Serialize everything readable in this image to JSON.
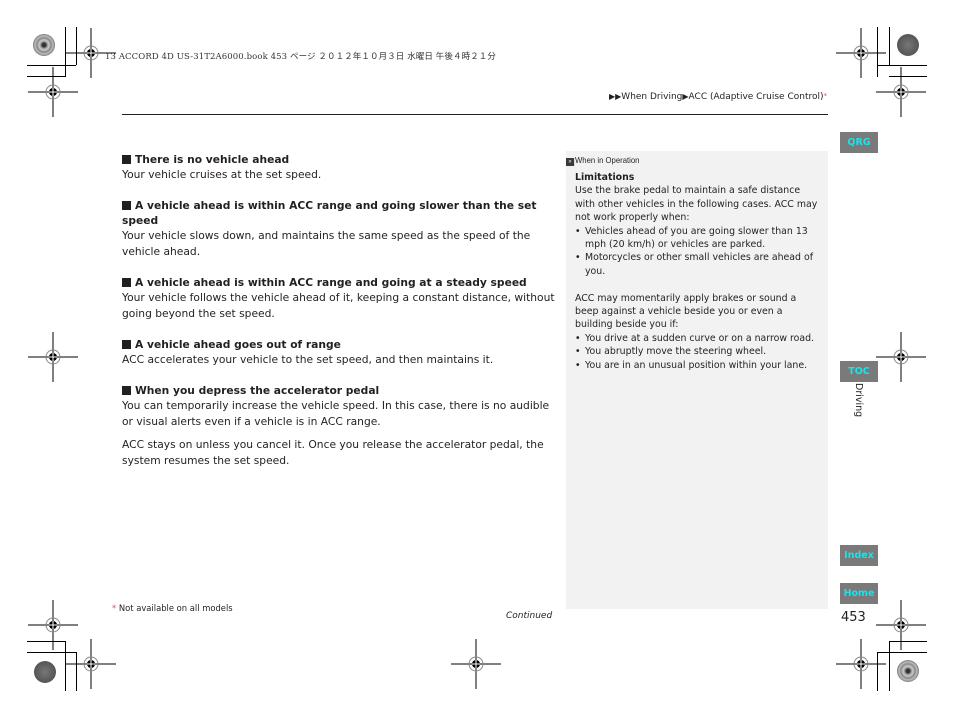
{
  "printer_header": "13 ACCORD 4D US-31T2A6000.book  453 ページ  ２０１２年１０月３日  水曜日  午後４時２１分",
  "breadcrumb": {
    "items": [
      "When Driving",
      "ACC (Adaptive Cruise Control)"
    ],
    "marker": "*"
  },
  "main": {
    "sections": [
      {
        "heading": "There is no vehicle ahead",
        "text": "Your vehicle cruises at the set speed."
      },
      {
        "heading": "A vehicle ahead is within ACC range and going slower than the set speed",
        "text": "Your vehicle slows down, and maintains the same speed as the speed of the vehicle ahead."
      },
      {
        "heading": "A vehicle ahead is within ACC range and going at a steady speed",
        "text": "Your vehicle follows the vehicle ahead of it, keeping a constant distance, without going beyond the set speed."
      },
      {
        "heading": "A vehicle ahead goes out of range",
        "text": "ACC accelerates your vehicle to the set speed, and then maintains it."
      },
      {
        "heading": "When you depress the accelerator pedal",
        "text": "You can temporarily increase the vehicle speed. In this case, there is no audible or visual alerts even if a vehicle is in ACC range.",
        "text2": "ACC stays on unless you cancel it. Once you release the accelerator pedal, the system resumes the set speed."
      }
    ]
  },
  "sidebar": {
    "header": "When in Operation",
    "title": "Limitations",
    "intro": "Use the brake pedal to maintain a safe distance with other vehicles in the following cases. ACC may not work properly when:",
    "bullets1": [
      "Vehicles ahead of you are going slower than 13 mph (20 km/h) or vehicles are parked.",
      "Motorcycles or other small vehicles are ahead of you."
    ],
    "para2": "ACC may momentarily apply brakes or sound a beep against a vehicle beside you or even a building beside you if:",
    "bullets2": [
      "You drive at a sudden curve or on a narrow road.",
      "You abruptly move the steering wheel.",
      "You are in an unusual position within your lane."
    ]
  },
  "nav_tabs": {
    "qrg": "QRG",
    "toc": "TOC",
    "index": "Index",
    "home": "Home",
    "chapter": "Driving"
  },
  "page_number": "453",
  "footnote": {
    "marker": "*",
    "text": "Not available on all models"
  },
  "continued": "Continued",
  "colors": {
    "tab_bg": "#7a7a7a",
    "tab_text": "#18e4ec",
    "sidebar_bg": "#f2f2f2",
    "asterisk": "#e0456a"
  }
}
